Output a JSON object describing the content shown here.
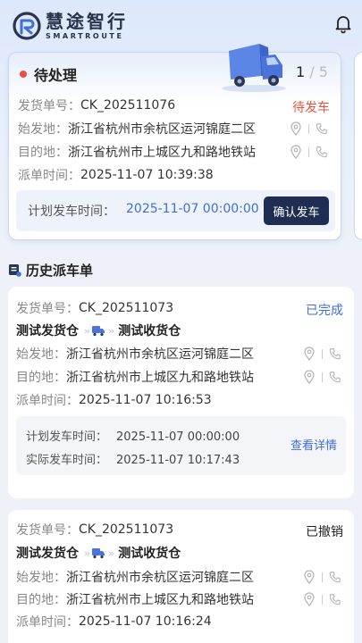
{
  "app": {
    "logo_cn": "慧途智行",
    "logo_en": "SMARTROUTE"
  },
  "pending": {
    "title": "待处理",
    "pager_current": "1",
    "pager_sep": "/",
    "pager_total": "5",
    "order_label": "发货单号：",
    "order_no": "CK_202511076",
    "status": "待发车",
    "origin_label": "始发地：",
    "origin": "浙江省杭州市余杭区运河锦庭二区",
    "dest_label": "目的地：",
    "dest": "浙江省杭州市上城区九和路地铁站",
    "dispatch_label": "派单时间：",
    "dispatch_time": "2025-11-07 10:39:38",
    "plan_label": "计划发车时间：",
    "plan_time": "2025-11-07 00:00:00",
    "confirm_btn": "确认发车"
  },
  "history": {
    "title": "历史派车单",
    "records": [
      {
        "order_label": "发货单号：",
        "order_no": "CK_202511073",
        "status": "已完成",
        "from_wh": "测试发货仓",
        "to_wh": "测试收货仓",
        "origin_label": "始发地：",
        "origin": "浙江省杭州市余杭区运河锦庭二区",
        "dest_label": "目的地：",
        "dest": "浙江省杭州市上城区九和路地铁站",
        "dispatch_label": "派单时间：",
        "dispatch_time": "2025-11-07 10:16:53",
        "plan_label": "计划发车时间：",
        "plan_time": "2025-11-07 00:00:00",
        "actual_label": "实际发车时间：",
        "actual_time": "2025-11-07 10:17:43",
        "detail_link": "查看详情"
      },
      {
        "order_label": "发货单号：",
        "order_no": "CK_202511073",
        "status": "已撤销",
        "from_wh": "测试发货仓",
        "to_wh": "测试收货仓",
        "origin_label": "始发地：",
        "origin": "浙江省杭州市余杭区运河锦庭二区",
        "dest_label": "目的地：",
        "dest": "浙江省杭州市上城区九和路地铁站",
        "dispatch_label": "派单时间：",
        "dispatch_time": "2025-11-07 10:16:24"
      }
    ]
  },
  "colors": {
    "status_pending": "#e8533f",
    "status_done": "#3f6fd8",
    "status_cancelled": "#222222",
    "primary_dark": "#1f2d52",
    "link_blue": "#3f6fd8"
  },
  "icons": [
    "logo-mark-icon",
    "bell-icon",
    "truck-illustration",
    "location-pin-icon",
    "phone-icon",
    "truck-icon",
    "document-list-icon"
  ]
}
